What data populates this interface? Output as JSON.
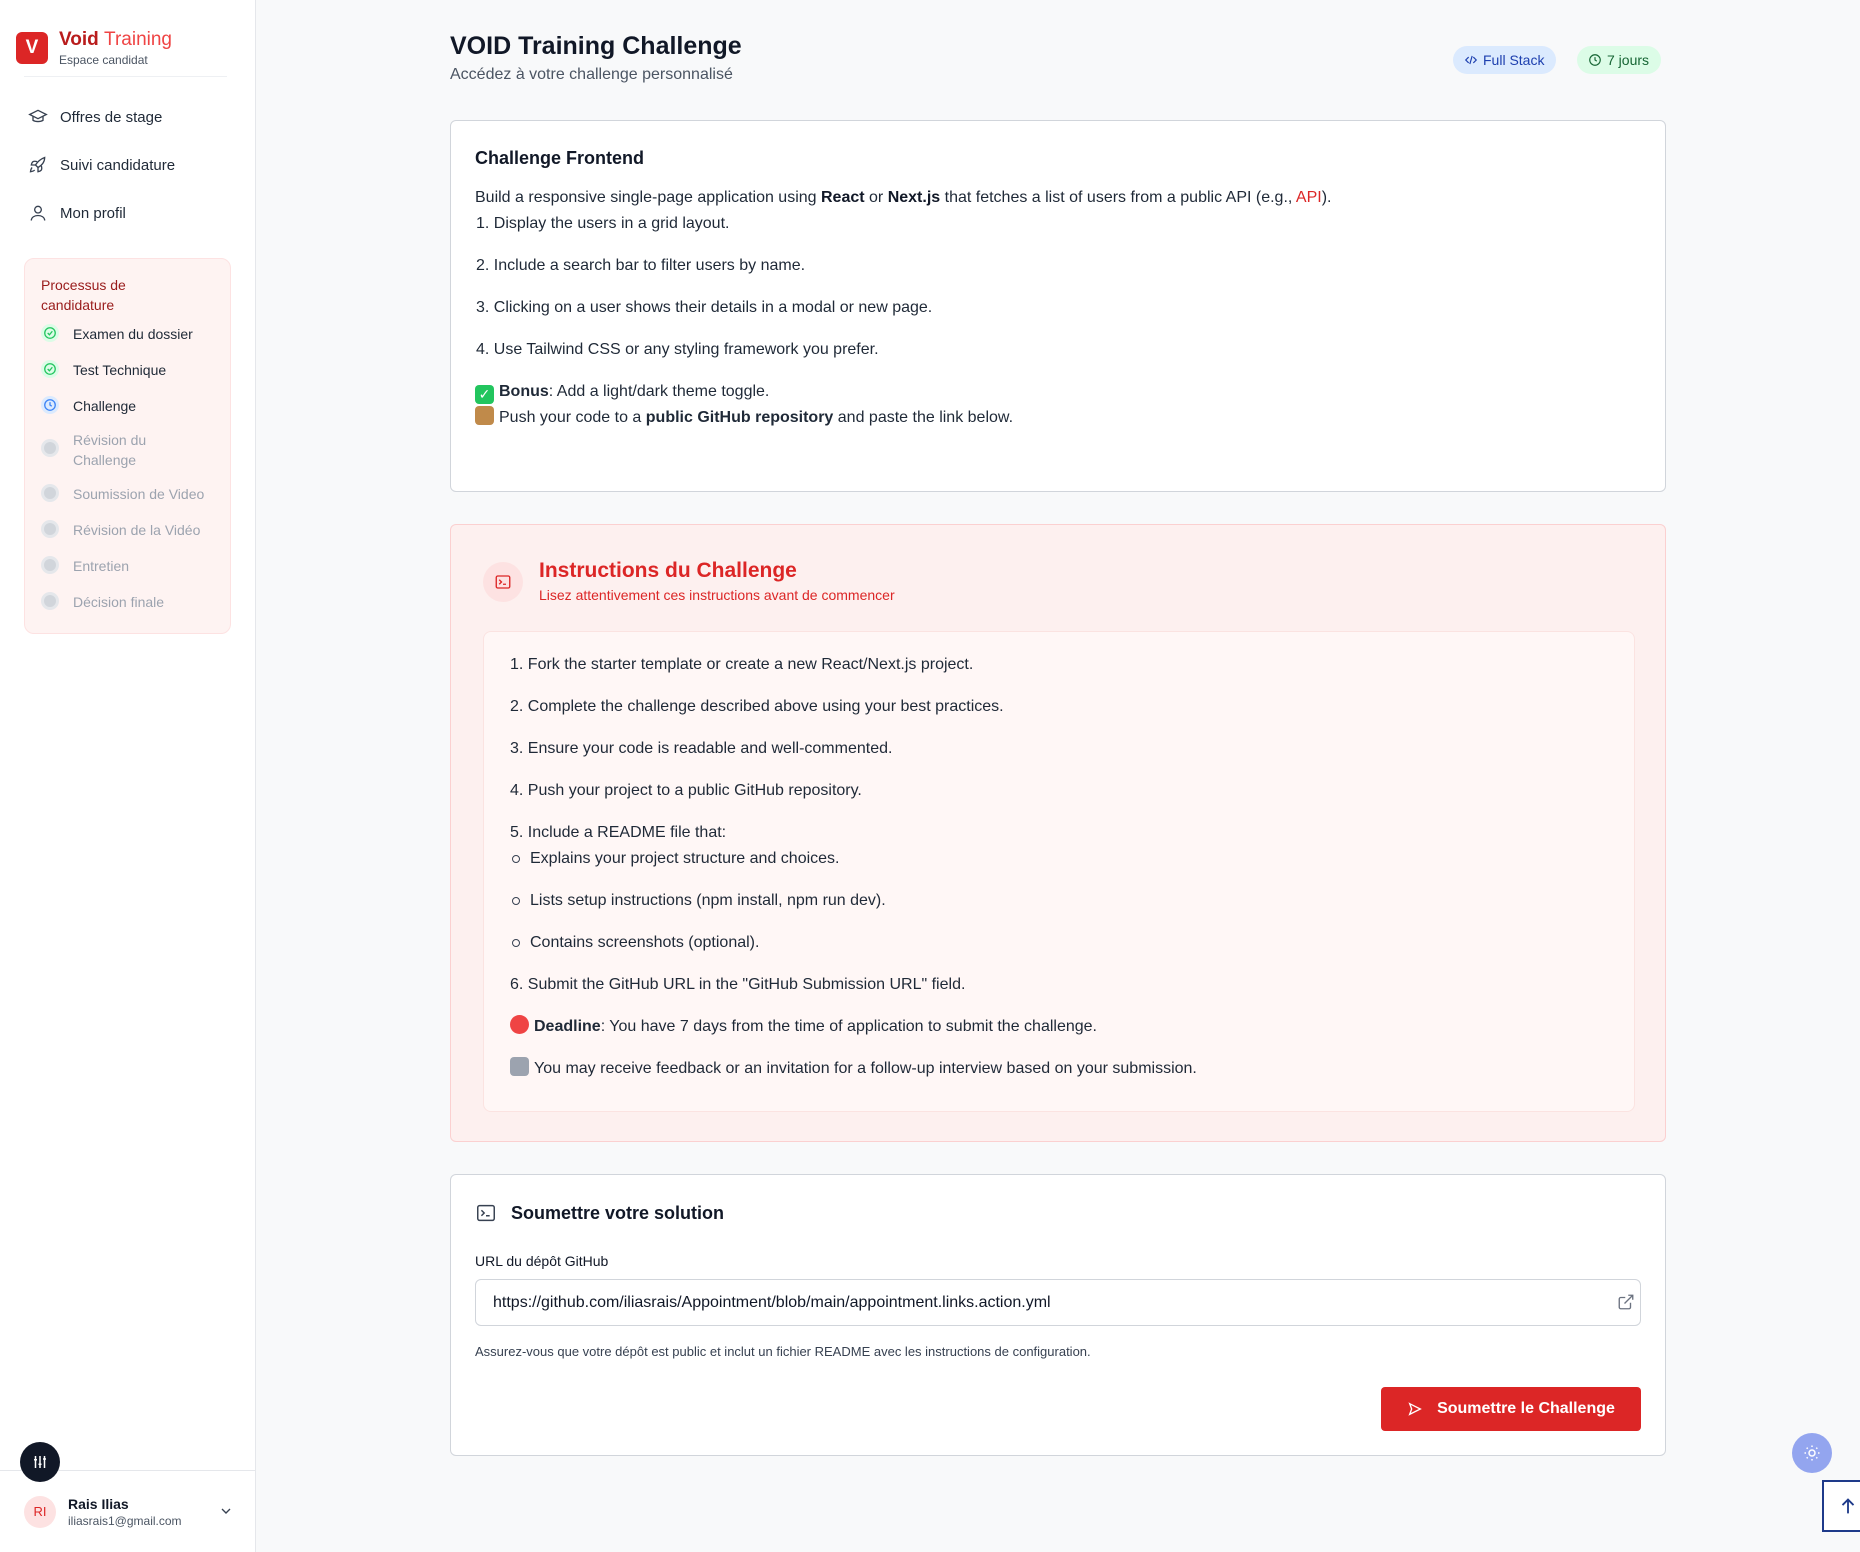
{
  "brand": {
    "letter": "V",
    "title_part1": "Void",
    "title_part2": "Training",
    "subtitle": "Espace candidat"
  },
  "nav": [
    {
      "label": "Offres de stage",
      "icon": "graduation-cap-icon"
    },
    {
      "label": "Suivi candidature",
      "icon": "rocket-icon"
    },
    {
      "label": "Mon profil",
      "icon": "user-icon"
    }
  ],
  "process": {
    "title": "Processus de candidature",
    "steps": [
      {
        "label": "Examen du dossier",
        "status": "done"
      },
      {
        "label": "Test Technique",
        "status": "done"
      },
      {
        "label": "Challenge",
        "status": "current"
      },
      {
        "label": "Révision du Challenge",
        "status": "pending"
      },
      {
        "label": "Soumission de Video",
        "status": "pending"
      },
      {
        "label": "Révision de la Vidéo",
        "status": "pending"
      },
      {
        "label": "Entretien",
        "status": "pending"
      },
      {
        "label": "Décision finale",
        "status": "pending"
      }
    ]
  },
  "user": {
    "initials": "RI",
    "name": "Rais Ilias",
    "email": "iliasrais1@gmail.com"
  },
  "header": {
    "title": "VOID Training Challenge",
    "subtitle": "Accédez à votre challenge personnalisé",
    "badge_stack": "Full Stack",
    "badge_days": "7 jours"
  },
  "challenge": {
    "title": "Challenge Frontend",
    "intro_a": "Build a responsive single-page application using ",
    "intro_react": "React",
    "intro_or": " or ",
    "intro_next": "Next.js",
    "intro_b": " that fetches a list of users from a public API (e.g., ",
    "intro_api": "API",
    "intro_c": ").",
    "items": [
      "1. Display the users in a grid layout.",
      "2. Include a search bar to filter users by name.",
      "3. Clicking on a user shows their details in a modal or new page.",
      "4. Use Tailwind CSS or any styling framework you prefer."
    ],
    "bonus_label": "Bonus",
    "bonus_text": ": Add a light/dark theme toggle.",
    "push_a": "Push your code to a ",
    "push_bold": "public GitHub repository",
    "push_b": " and paste the link below."
  },
  "instructions": {
    "title": "Instructions du Challenge",
    "subtitle": "Lisez attentivement ces instructions avant de commencer",
    "lines": [
      "1. Fork the starter template or create a new React/Next.js project.",
      "2. Complete the challenge described above using your best practices.",
      "3. Ensure your code is readable and well-commented.",
      "4. Push your project to a public GitHub repository.",
      "5. Include a README file that:"
    ],
    "bullets": [
      "Explains your project structure and choices.",
      "Lists setup instructions (npm install, npm run dev).",
      "Contains screenshots (optional)."
    ],
    "line6": "6. Submit the GitHub URL in the \"GitHub Submission URL\" field.",
    "deadline_label": "Deadline",
    "deadline_text": ": You have 7 days from the time of application to submit the challenge.",
    "feedback": "You may receive feedback or an invitation for a follow-up interview based on your submission."
  },
  "submit": {
    "title": "Soumettre votre solution",
    "field_label": "URL du dépôt GitHub",
    "url_value": "https://github.com/iliasrais/Appointment/blob/main/appointment.links.action.yml",
    "help": "Assurez-vous que votre dépôt est public et inclut un fichier README avec les instructions de configuration.",
    "button": "Soumettre le Challenge"
  },
  "colors": {
    "accent": "#dc2626",
    "done": "#22c55e",
    "current": "#3b82f6"
  }
}
